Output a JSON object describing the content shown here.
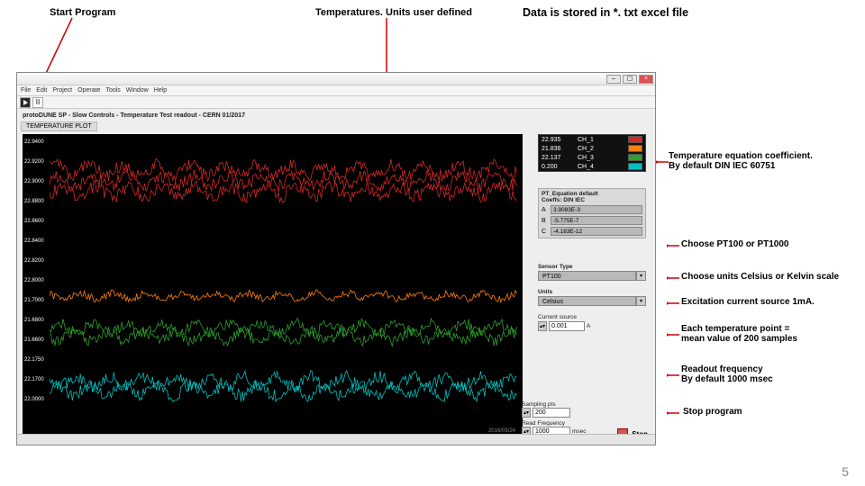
{
  "callouts": {
    "start": "Start Program",
    "temps": "Temperatures. Units user defined",
    "stored": "Data is stored in *. txt excel file",
    "coef": "Temperature equation coefficient.\nBy default DIN IEC 60751",
    "sensor": "Choose PT100 or PT1000",
    "units": "Choose units Celsius or Kelvin scale",
    "current": "Excitation current source 1mA.",
    "samples": "Each temperature point =\nmean value of 200 samples",
    "freq": "Readout frequency\nBy default 1000 msec",
    "stop": "Stop program"
  },
  "window": {
    "menus": [
      "File",
      "Edit",
      "Project",
      "Operate",
      "Tools",
      "Window",
      "Help"
    ]
  },
  "panel": {
    "title": "protoDUNE SP - Slow Controls - Temperature Test readout - CERN 01/2017",
    "tab": "TEMPERATURE PLOT"
  },
  "legend": {
    "rows": [
      {
        "val": "22.935",
        "name": "CH_1",
        "color": "#d62728"
      },
      {
        "val": "21.836",
        "name": "CH_2",
        "color": "#ff7f0e"
      },
      {
        "val": "22.137",
        "name": "CH_3",
        "color": "#2ca02c"
      },
      {
        "val": "0.200",
        "name": "CH_4",
        "color": "#00bfbf"
      }
    ]
  },
  "coef": {
    "header": "PT_Equation default\nCoeffs: DIN IEC",
    "a_label": "A",
    "a": "3.9083E-3",
    "b_label": "B",
    "b": "-5.775E-7",
    "c_label": "C",
    "c": "-4.183E-12"
  },
  "sensor": {
    "label": "Sensor Type",
    "value": "PT100"
  },
  "units": {
    "label": "Units",
    "value": "Celsius"
  },
  "current": {
    "label": "Current source",
    "value": "0.001",
    "unit": "A"
  },
  "sampling": {
    "label": "Sampling pts",
    "value": "200"
  },
  "readfreq": {
    "label": "Read Frequency",
    "value": "1000",
    "unit": "msec"
  },
  "stop": {
    "label": "Stop"
  },
  "timestamps": {
    "start": "",
    "end": "2016/05/24"
  },
  "page_number": "5",
  "chart_data": {
    "type": "line",
    "y_ticks": [
      "22.9400",
      "22.9200",
      "22.9000",
      "22.8800",
      "22.8600",
      "22.8400",
      "22.8200",
      "22.8000",
      "21.7000",
      "21.6800",
      "21.6600",
      "22.1750",
      "22.1700",
      "22.0000"
    ],
    "series": [
      {
        "name": "CH_1",
        "color": "#d62728",
        "values": [
          22.935,
          22.932,
          22.938,
          22.929,
          22.94,
          22.925,
          22.936,
          22.93,
          22.928,
          22.934,
          22.922,
          22.931,
          22.927,
          22.933,
          22.924,
          22.93,
          22.936,
          22.921,
          22.929,
          22.933
        ]
      },
      {
        "name": "CH_2",
        "color": "#ff7f0e",
        "values": [
          21.845,
          21.84,
          21.848,
          21.836,
          21.842,
          21.834,
          21.839,
          21.843,
          21.831,
          21.838,
          21.844,
          21.833,
          21.84,
          21.836,
          21.841,
          21.83,
          21.837,
          21.842,
          21.835,
          21.838
        ]
      },
      {
        "name": "CH_3",
        "color": "#2ca02c",
        "values": [
          22.177,
          22.174,
          22.179,
          22.173,
          22.178,
          22.172,
          22.176,
          22.175,
          22.171,
          22.177,
          22.174,
          22.17,
          22.176,
          22.173,
          22.178,
          22.172,
          22.175,
          22.177,
          22.171,
          22.176
        ]
      },
      {
        "name": "CH_4",
        "color": "#00bfbf",
        "values": [
          22.006,
          22.001,
          22.008,
          21.998,
          22.005,
          21.996,
          22.003,
          22.0,
          21.997,
          22.004,
          21.999,
          22.006,
          21.995,
          22.002,
          22.007,
          21.998,
          22.004,
          21.996,
          22.001,
          22.005
        ]
      }
    ]
  }
}
